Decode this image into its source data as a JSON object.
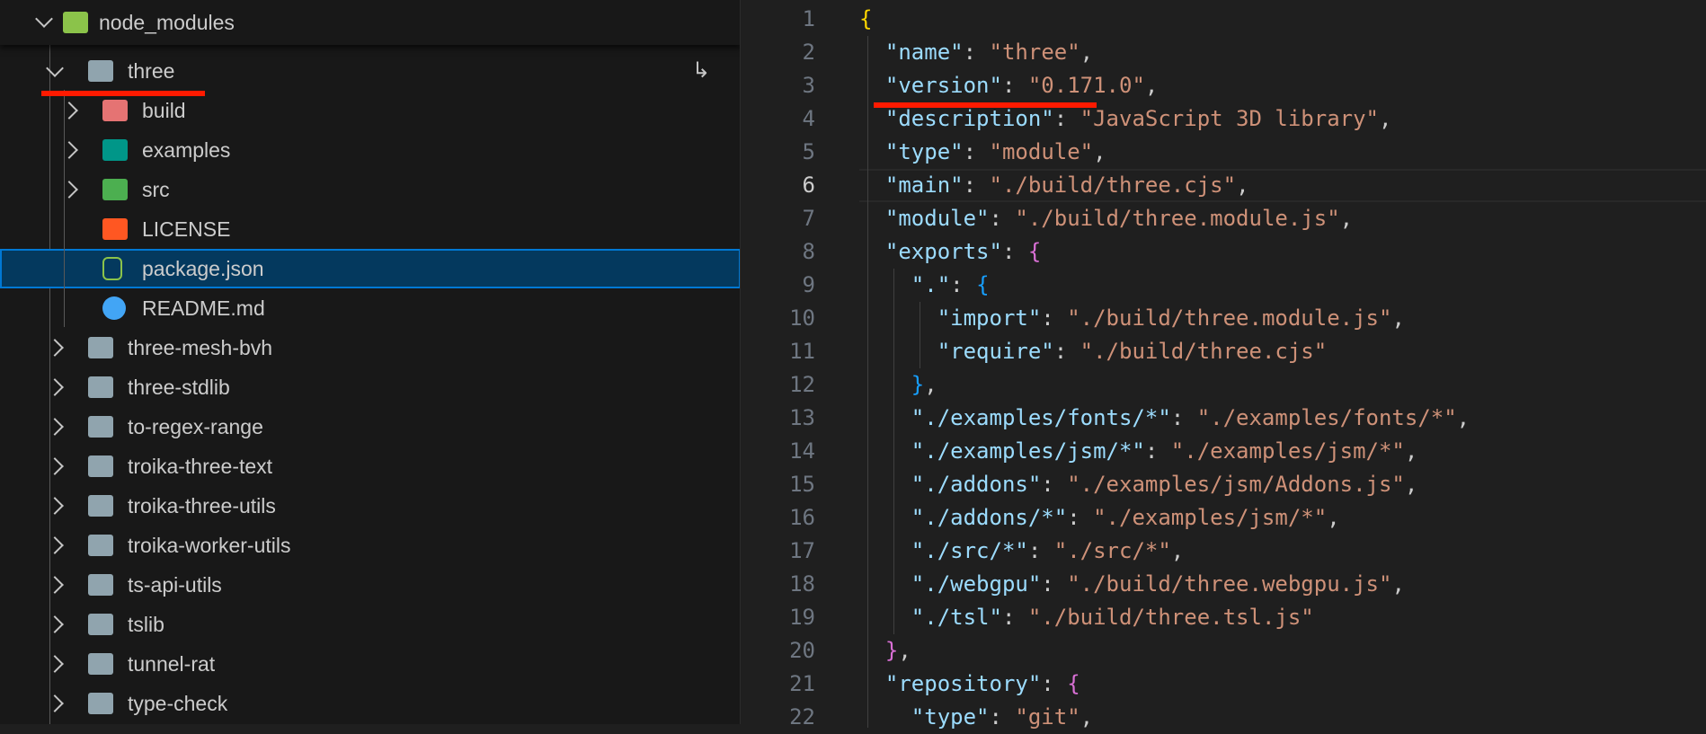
{
  "explorer": {
    "sticky": {
      "label": "node_modules",
      "icon": "folder-node-icon"
    },
    "items": [
      {
        "label": "three",
        "icon": "folder-open-icon",
        "level": 1,
        "expanded": true,
        "folder": true
      },
      {
        "label": "build",
        "icon": "folder-build-icon",
        "level": 2,
        "folder": true
      },
      {
        "label": "examples",
        "icon": "folder-images-icon",
        "level": 2,
        "folder": true
      },
      {
        "label": "src",
        "icon": "folder-src-icon",
        "level": 2,
        "folder": true
      },
      {
        "label": "LICENSE",
        "icon": "license-icon",
        "level": 2,
        "folder": false
      },
      {
        "label": "package.json",
        "icon": "nodejs-icon",
        "level": 2,
        "folder": false,
        "selected": true
      },
      {
        "label": "README.md",
        "icon": "info-icon",
        "level": 2,
        "folder": false
      },
      {
        "label": "three-mesh-bvh",
        "icon": "folder-icon",
        "level": 1,
        "folder": true
      },
      {
        "label": "three-stdlib",
        "icon": "folder-icon",
        "level": 1,
        "folder": true
      },
      {
        "label": "to-regex-range",
        "icon": "folder-icon",
        "level": 1,
        "folder": true
      },
      {
        "label": "troika-three-text",
        "icon": "folder-icon",
        "level": 1,
        "folder": true
      },
      {
        "label": "troika-three-utils",
        "icon": "folder-icon",
        "level": 1,
        "folder": true
      },
      {
        "label": "troika-worker-utils",
        "icon": "folder-icon",
        "level": 1,
        "folder": true
      },
      {
        "label": "ts-api-utils",
        "icon": "folder-icon",
        "level": 1,
        "folder": true
      },
      {
        "label": "tslib",
        "icon": "folder-icon",
        "level": 1,
        "folder": true
      },
      {
        "label": "tunnel-rat",
        "icon": "folder-icon",
        "level": 1,
        "folder": true
      },
      {
        "label": "type-check",
        "icon": "folder-icon",
        "level": 1,
        "folder": true
      }
    ]
  },
  "editor": {
    "active_line": 6,
    "lines": [
      [
        {
          "t": "{",
          "c": "b1"
        }
      ],
      [
        {
          "t": "  "
        },
        {
          "t": "\"name\"",
          "c": "k"
        },
        {
          "t": ": ",
          "c": "p"
        },
        {
          "t": "\"three\"",
          "c": "s"
        },
        {
          "t": ",",
          "c": "p"
        }
      ],
      [
        {
          "t": "  "
        },
        {
          "t": "\"version\"",
          "c": "k"
        },
        {
          "t": ": ",
          "c": "p"
        },
        {
          "t": "\"0.171.0\"",
          "c": "s"
        },
        {
          "t": ",",
          "c": "p"
        }
      ],
      [
        {
          "t": "  "
        },
        {
          "t": "\"description\"",
          "c": "k"
        },
        {
          "t": ": ",
          "c": "p"
        },
        {
          "t": "\"JavaScript 3D library\"",
          "c": "s"
        },
        {
          "t": ",",
          "c": "p"
        }
      ],
      [
        {
          "t": "  "
        },
        {
          "t": "\"type\"",
          "c": "k"
        },
        {
          "t": ": ",
          "c": "p"
        },
        {
          "t": "\"module\"",
          "c": "s"
        },
        {
          "t": ",",
          "c": "p"
        }
      ],
      [
        {
          "t": "  "
        },
        {
          "t": "\"main\"",
          "c": "k"
        },
        {
          "t": ": ",
          "c": "p"
        },
        {
          "t": "\"./build/three.cjs\"",
          "c": "s"
        },
        {
          "t": ",",
          "c": "p"
        }
      ],
      [
        {
          "t": "  "
        },
        {
          "t": "\"module\"",
          "c": "k"
        },
        {
          "t": ": ",
          "c": "p"
        },
        {
          "t": "\"./build/three.module.js\"",
          "c": "s"
        },
        {
          "t": ",",
          "c": "p"
        }
      ],
      [
        {
          "t": "  "
        },
        {
          "t": "\"exports\"",
          "c": "k"
        },
        {
          "t": ": ",
          "c": "p"
        },
        {
          "t": "{",
          "c": "b2"
        }
      ],
      [
        {
          "t": "    "
        },
        {
          "t": "\".\"",
          "c": "k"
        },
        {
          "t": ": ",
          "c": "p"
        },
        {
          "t": "{",
          "c": "b3"
        }
      ],
      [
        {
          "t": "      "
        },
        {
          "t": "\"import\"",
          "c": "k"
        },
        {
          "t": ": ",
          "c": "p"
        },
        {
          "t": "\"./build/three.module.js\"",
          "c": "s"
        },
        {
          "t": ",",
          "c": "p"
        }
      ],
      [
        {
          "t": "      "
        },
        {
          "t": "\"require\"",
          "c": "k"
        },
        {
          "t": ": ",
          "c": "p"
        },
        {
          "t": "\"./build/three.cjs\"",
          "c": "s"
        }
      ],
      [
        {
          "t": "    "
        },
        {
          "t": "}",
          "c": "b3"
        },
        {
          "t": ",",
          "c": "p"
        }
      ],
      [
        {
          "t": "    "
        },
        {
          "t": "\"./examples/fonts/*\"",
          "c": "k"
        },
        {
          "t": ": ",
          "c": "p"
        },
        {
          "t": "\"./examples/fonts/*\"",
          "c": "s"
        },
        {
          "t": ",",
          "c": "p"
        }
      ],
      [
        {
          "t": "    "
        },
        {
          "t": "\"./examples/jsm/*\"",
          "c": "k"
        },
        {
          "t": ": ",
          "c": "p"
        },
        {
          "t": "\"./examples/jsm/*\"",
          "c": "s"
        },
        {
          "t": ",",
          "c": "p"
        }
      ],
      [
        {
          "t": "    "
        },
        {
          "t": "\"./addons\"",
          "c": "k"
        },
        {
          "t": ": ",
          "c": "p"
        },
        {
          "t": "\"./examples/jsm/Addons.js\"",
          "c": "s"
        },
        {
          "t": ",",
          "c": "p"
        }
      ],
      [
        {
          "t": "    "
        },
        {
          "t": "\"./addons/*\"",
          "c": "k"
        },
        {
          "t": ": ",
          "c": "p"
        },
        {
          "t": "\"./examples/jsm/*\"",
          "c": "s"
        },
        {
          "t": ",",
          "c": "p"
        }
      ],
      [
        {
          "t": "    "
        },
        {
          "t": "\"./src/*\"",
          "c": "k"
        },
        {
          "t": ": ",
          "c": "p"
        },
        {
          "t": "\"./src/*\"",
          "c": "s"
        },
        {
          "t": ",",
          "c": "p"
        }
      ],
      [
        {
          "t": "    "
        },
        {
          "t": "\"./webgpu\"",
          "c": "k"
        },
        {
          "t": ": ",
          "c": "p"
        },
        {
          "t": "\"./build/three.webgpu.js\"",
          "c": "s"
        },
        {
          "t": ",",
          "c": "p"
        }
      ],
      [
        {
          "t": "    "
        },
        {
          "t": "\"./tsl\"",
          "c": "k"
        },
        {
          "t": ": ",
          "c": "p"
        },
        {
          "t": "\"./build/three.tsl.js\"",
          "c": "s"
        }
      ],
      [
        {
          "t": "  "
        },
        {
          "t": "}",
          "c": "b2"
        },
        {
          "t": ",",
          "c": "p"
        }
      ],
      [
        {
          "t": "  "
        },
        {
          "t": "\"repository\"",
          "c": "k"
        },
        {
          "t": ": ",
          "c": "p"
        },
        {
          "t": "{",
          "c": "b2"
        }
      ],
      [
        {
          "t": "    "
        },
        {
          "t": "\"type\"",
          "c": "k"
        },
        {
          "t": ": ",
          "c": "p"
        },
        {
          "t": "\"git\"",
          "c": "s"
        },
        {
          "t": ",",
          "c": "p"
        }
      ]
    ]
  },
  "colors": {
    "selection": "#04395e",
    "annotation": "#ff1a00",
    "key": "#9cdcfe",
    "string": "#ce9178"
  }
}
